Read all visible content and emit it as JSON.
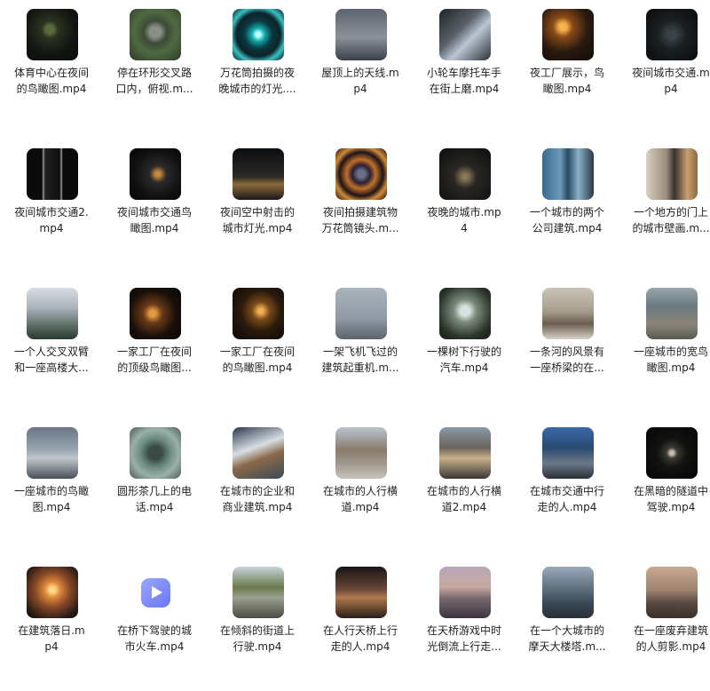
{
  "files": [
    {
      "lines": [
        "体育中心在夜间",
        "的鸟瞰图.mp4"
      ],
      "thumb": "night-stadium"
    },
    {
      "lines": [
        "停在环形交叉路",
        "口内，俯视.m..."
      ],
      "thumb": "roundabout"
    },
    {
      "lines": [
        "万花筒拍摄的夜",
        "晚城市的灯光...."
      ],
      "thumb": "kaleido-cyan"
    },
    {
      "lines": [
        "屋顶上的天线.m",
        "p4"
      ],
      "thumb": "antenna"
    },
    {
      "lines": [
        "小轮车摩托车手",
        "在街上磨.mp4"
      ],
      "thumb": "bmx-street"
    },
    {
      "lines": [
        "夜工厂展示，鸟",
        "瞰图.mp4"
      ],
      "thumb": "night-factory"
    },
    {
      "lines": [
        "夜间城市交通.m",
        "p4"
      ],
      "thumb": "night-traffic"
    },
    {
      "lines": [
        "夜间城市交通2.",
        "mp4"
      ],
      "thumb": "night-road"
    },
    {
      "lines": [
        "夜间城市交通鸟",
        "瞰图.mp4"
      ],
      "thumb": "night-interchange"
    },
    {
      "lines": [
        "夜间空中射击的",
        "城市灯光.mp4"
      ],
      "thumb": "night-aerial"
    },
    {
      "lines": [
        "夜间拍摄建筑物",
        "万花筒镜头.m..."
      ],
      "thumb": "kaleido-orange"
    },
    {
      "lines": [
        "夜晚的城市.mp",
        "4"
      ],
      "thumb": "night-city"
    },
    {
      "lines": [
        "一个城市的两个",
        "公司建筑.mp4"
      ],
      "thumb": "two-towers"
    },
    {
      "lines": [
        "一个地方的门上",
        "的城市壁画.m..."
      ],
      "thumb": "mural-door"
    },
    {
      "lines": [
        "一个人交叉双臂",
        "和一座高楼大..."
      ],
      "thumb": "highrise"
    },
    {
      "lines": [
        "一家工厂在夜间",
        "的顶级鸟瞰图..."
      ],
      "thumb": "factory-top"
    },
    {
      "lines": [
        "一家工厂在夜间",
        "的鸟瞰图.mp4"
      ],
      "thumb": "factory-night"
    },
    {
      "lines": [
        "一架飞机飞过的",
        "建筑起重机.m..."
      ],
      "thumb": "crane"
    },
    {
      "lines": [
        "一棵树下行驶的",
        "汽车.mp4"
      ],
      "thumb": "tree-car"
    },
    {
      "lines": [
        "一条河的风景有",
        "一座桥梁的在..."
      ],
      "thumb": "river-bridge"
    },
    {
      "lines": [
        "一座城市的宽鸟",
        "瞰图.mp4"
      ],
      "thumb": "city-wide"
    },
    {
      "lines": [
        "一座城市的鸟瞰",
        "图.mp4"
      ],
      "thumb": "city-cloudy"
    },
    {
      "lines": [
        "圆形茶几上的电",
        "话.mp4"
      ],
      "thumb": "phone-table"
    },
    {
      "lines": [
        "在城市的企业和",
        "商业建筑.mp4"
      ],
      "thumb": "business-buildings"
    },
    {
      "lines": [
        "在城市的人行横",
        "道.mp4"
      ],
      "thumb": "crosswalk"
    },
    {
      "lines": [
        "在城市的人行横",
        "道2.mp4"
      ],
      "thumb": "crosswalk2"
    },
    {
      "lines": [
        "在城市交通中行",
        "走的人.mp4"
      ],
      "thumb": "walking-traffic"
    },
    {
      "lines": [
        "在黑暗的隧道中",
        "驾驶.mp4"
      ],
      "thumb": "dark-tunnel"
    },
    {
      "lines": [
        "在建筑落日.m",
        "p4"
      ],
      "thumb": "sunset-building"
    },
    {
      "lines": [
        "在桥下驾驶的城",
        "市火车.mp4"
      ],
      "thumb": "video-file-icon"
    },
    {
      "lines": [
        "在倾斜的街道上",
        "行驶.mp4"
      ],
      "thumb": "sloped-street"
    },
    {
      "lines": [
        "在人行天桥上行",
        "走的人.mp4"
      ],
      "thumb": "footbridge"
    },
    {
      "lines": [
        "在天桥游戏中时",
        "光倒流上行走..."
      ],
      "thumb": "overpass-timelapse"
    },
    {
      "lines": [
        "在一个大城市的",
        "摩天大楼塔.m..."
      ],
      "thumb": "skyscraper-towers"
    },
    {
      "lines": [
        "在一座废弃建筑",
        "的人剪影.mp4"
      ],
      "thumb": "silhouette-abandoned"
    }
  ]
}
